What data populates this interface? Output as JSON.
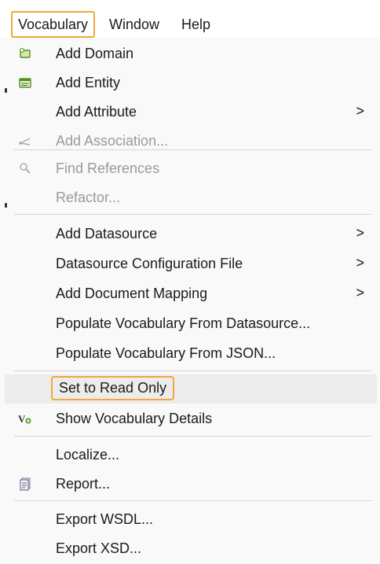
{
  "menubar": {
    "items": [
      {
        "label": "Vocabulary"
      },
      {
        "label": "Window"
      },
      {
        "label": "Help"
      }
    ]
  },
  "menu": {
    "items": [
      {
        "label": "Add Domain",
        "icon": "domain-icon"
      },
      {
        "label": "Add Entity",
        "icon": "entity-icon"
      },
      {
        "label": "Add Attribute",
        "submenu": ">"
      },
      {
        "label": "Add Association...",
        "icon": "association-icon",
        "disabled": true
      },
      {
        "label": "Find References",
        "icon": "search-icon",
        "disabled": true
      },
      {
        "label": "Refactor...",
        "disabled": true
      },
      {
        "label": "Add Datasource",
        "submenu": ">"
      },
      {
        "label": "Datasource Configuration File",
        "submenu": ">"
      },
      {
        "label": "Add Document Mapping",
        "submenu": ">"
      },
      {
        "label": "Populate Vocabulary From Datasource..."
      },
      {
        "label": "Populate Vocabulary From JSON..."
      },
      {
        "label": "Set to Read Only",
        "highlighted": true
      },
      {
        "label": "Show Vocabulary Details",
        "icon": "vocabulary-details-icon"
      },
      {
        "label": "Localize..."
      },
      {
        "label": "Report...",
        "icon": "report-icon"
      },
      {
        "label": "Export WSDL..."
      },
      {
        "label": "Export XSD..."
      }
    ]
  },
  "colors": {
    "highlight_border": "#f0a838",
    "menu_background": "#f9f9f9",
    "disabled_text": "#9a9a9a",
    "separator": "#d6d6d6"
  }
}
